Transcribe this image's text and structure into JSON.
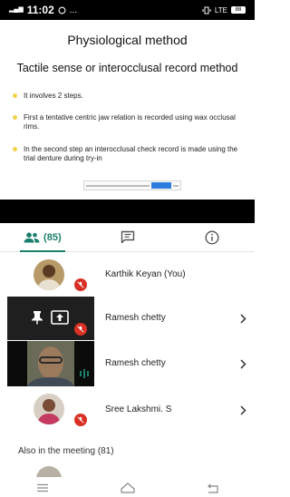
{
  "status_bar": {
    "time": "11:02",
    "signal_glyph": "⁴⁶",
    "more": "...",
    "net": "LTE",
    "battery": "88"
  },
  "slide": {
    "title": "Physiological method",
    "subtitle": "Tactile sense or interocclusal record method",
    "bullets": [
      "It involves 2 steps.",
      "First a tentative centric jaw relation is recorded using wax occlusal rims.",
      "In the second step an interocclusal check record is made using the trial denture during try-in"
    ]
  },
  "tabs": {
    "people_count": "(85)"
  },
  "participants": [
    {
      "name": "Karthik Keyan (You)"
    },
    {
      "name": "Ramesh chetty"
    },
    {
      "name": "Ramesh chetty"
    },
    {
      "name": "Sree Lakshmi. S"
    }
  ],
  "section": {
    "also_in_meeting": "Also in the meeting (81)"
  },
  "colors": {
    "accent": "#1a7f6d",
    "mic_off": "#d93025",
    "bullet": "#f2d24b"
  }
}
